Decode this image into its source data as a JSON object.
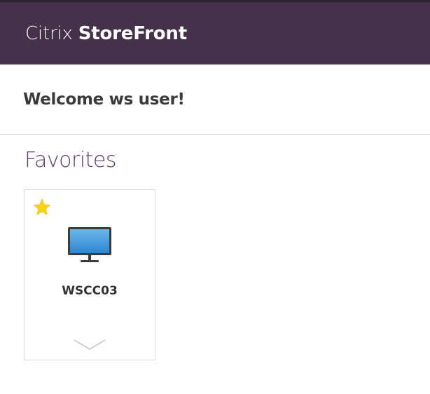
{
  "header": {
    "brand_light": "Citrix ",
    "brand_bold": "StoreFront",
    "background_color": "#46314b"
  },
  "welcome": {
    "text": "Welcome ws user!"
  },
  "favorites": {
    "title": "Favorites",
    "title_color": "#5b3e66",
    "apps": [
      {
        "name": "WSCC03",
        "icon": "desktop-monitor-icon",
        "favorite": true,
        "favorite_icon": "star-icon",
        "details_icon": "chevron-down-icon"
      }
    ]
  }
}
